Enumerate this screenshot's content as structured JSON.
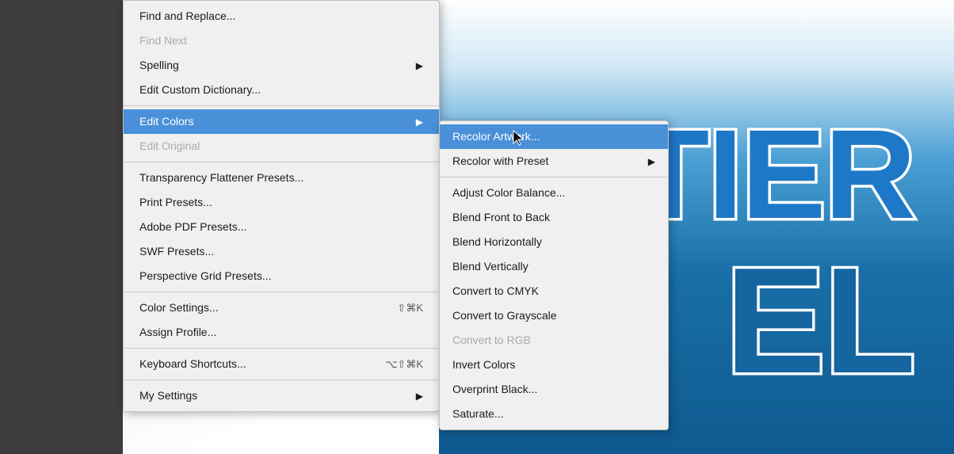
{
  "canvas": {
    "bg_text_tier": "TIER",
    "bg_text_el": "EL"
  },
  "main_menu": {
    "items": [
      {
        "id": "find-replace",
        "label": "Find and Replace...",
        "shortcut": "",
        "has_arrow": false,
        "disabled": false,
        "separator_after": false
      },
      {
        "id": "find-next",
        "label": "Find Next",
        "shortcut": "",
        "has_arrow": false,
        "disabled": true,
        "separator_after": false
      },
      {
        "id": "spelling",
        "label": "Spelling",
        "shortcut": "",
        "has_arrow": true,
        "disabled": false,
        "separator_after": false
      },
      {
        "id": "edit-custom-dictionary",
        "label": "Edit Custom Dictionary...",
        "shortcut": "",
        "has_arrow": false,
        "disabled": false,
        "separator_after": true
      },
      {
        "id": "edit-colors",
        "label": "Edit Colors",
        "shortcut": "",
        "has_arrow": true,
        "disabled": false,
        "active": true,
        "separator_after": false
      },
      {
        "id": "edit-original",
        "label": "Edit Original",
        "shortcut": "",
        "has_arrow": false,
        "disabled": true,
        "separator_after": true
      },
      {
        "id": "transparency-flattener",
        "label": "Transparency Flattener Presets...",
        "shortcut": "",
        "has_arrow": false,
        "disabled": false,
        "separator_after": false
      },
      {
        "id": "print-presets",
        "label": "Print Presets...",
        "shortcut": "",
        "has_arrow": false,
        "disabled": false,
        "separator_after": false
      },
      {
        "id": "adobe-pdf-presets",
        "label": "Adobe PDF Presets...",
        "shortcut": "",
        "has_arrow": false,
        "disabled": false,
        "separator_after": false
      },
      {
        "id": "swf-presets",
        "label": "SWF Presets...",
        "shortcut": "",
        "has_arrow": false,
        "disabled": false,
        "separator_after": false
      },
      {
        "id": "perspective-grid",
        "label": "Perspective Grid Presets...",
        "shortcut": "",
        "has_arrow": false,
        "disabled": false,
        "separator_after": true
      },
      {
        "id": "color-settings",
        "label": "Color Settings...",
        "shortcut": "⇧⌘K",
        "has_arrow": false,
        "disabled": false,
        "separator_after": false
      },
      {
        "id": "assign-profile",
        "label": "Assign Profile...",
        "shortcut": "",
        "has_arrow": false,
        "disabled": false,
        "separator_after": true
      },
      {
        "id": "keyboard-shortcuts",
        "label": "Keyboard Shortcuts...",
        "shortcut": "⌥⇧⌘K",
        "has_arrow": false,
        "disabled": false,
        "separator_after": true
      },
      {
        "id": "my-settings",
        "label": "My Settings",
        "shortcut": "",
        "has_arrow": true,
        "disabled": false,
        "separator_after": false
      }
    ]
  },
  "submenu": {
    "items": [
      {
        "id": "recolor-artwork",
        "label": "Recolor Artwork...",
        "has_arrow": false,
        "disabled": false,
        "active": true
      },
      {
        "id": "recolor-preset",
        "label": "Recolor with Preset",
        "has_arrow": true,
        "disabled": false,
        "active": false
      },
      {
        "id": "sep1",
        "separator": true
      },
      {
        "id": "adjust-color-balance",
        "label": "Adjust Color Balance...",
        "has_arrow": false,
        "disabled": false,
        "active": false
      },
      {
        "id": "blend-front-to-back",
        "label": "Blend Front to Back",
        "has_arrow": false,
        "disabled": false,
        "active": false
      },
      {
        "id": "blend-horizontally",
        "label": "Blend Horizontally",
        "has_arrow": false,
        "disabled": false,
        "active": false
      },
      {
        "id": "blend-vertically",
        "label": "Blend Vertically",
        "has_arrow": false,
        "disabled": false,
        "active": false
      },
      {
        "id": "convert-cmyk",
        "label": "Convert to CMYK",
        "has_arrow": false,
        "disabled": false,
        "active": false
      },
      {
        "id": "convert-grayscale",
        "label": "Convert to Grayscale",
        "has_arrow": false,
        "disabled": false,
        "active": false
      },
      {
        "id": "convert-rgb",
        "label": "Convert to RGB",
        "has_arrow": false,
        "disabled": true,
        "active": false
      },
      {
        "id": "invert-colors",
        "label": "Invert Colors",
        "has_arrow": false,
        "disabled": false,
        "active": false
      },
      {
        "id": "overprint-black",
        "label": "Overprint Black...",
        "has_arrow": false,
        "disabled": false,
        "active": false
      },
      {
        "id": "saturate",
        "label": "Saturate...",
        "has_arrow": false,
        "disabled": false,
        "active": false
      }
    ]
  }
}
